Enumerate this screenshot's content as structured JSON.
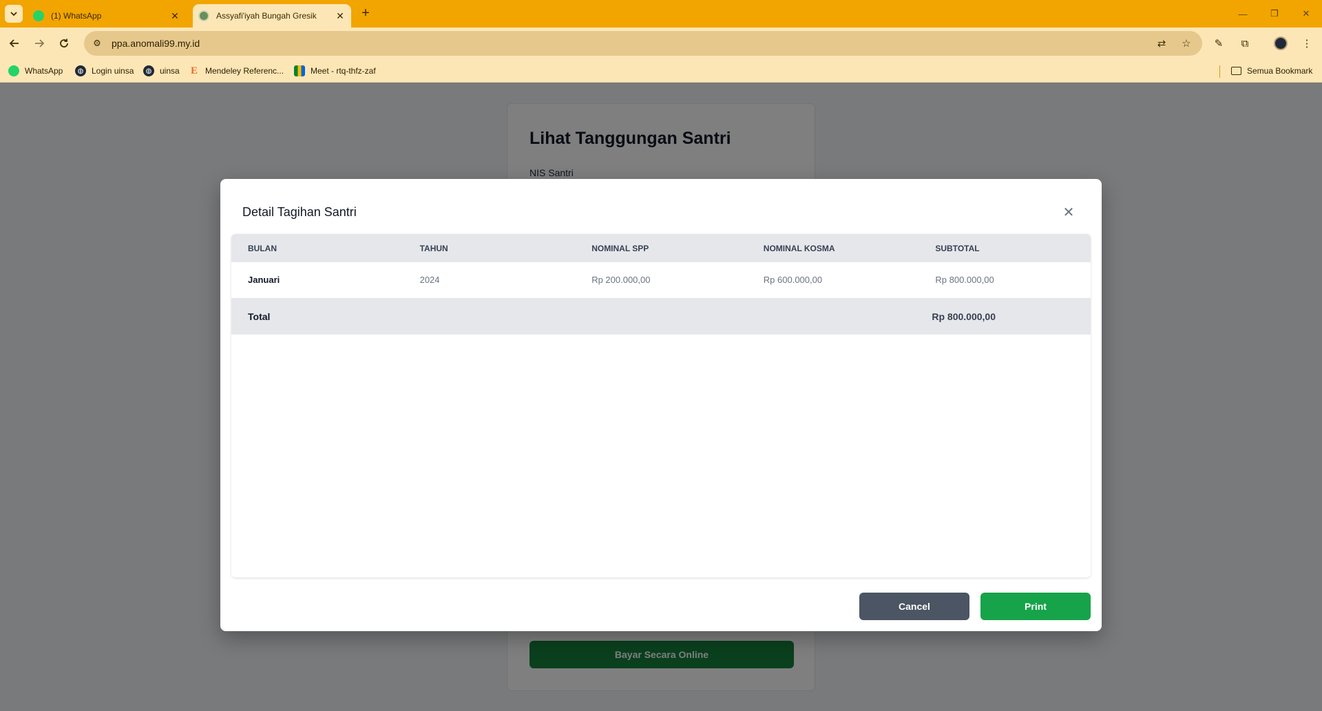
{
  "browser": {
    "tabs": [
      {
        "title": "(1) WhatsApp",
        "favicon": "whatsapp-icon",
        "active": false
      },
      {
        "title": "Assyafi'iyah Bungah Gresik",
        "favicon": "site-icon",
        "active": true
      }
    ],
    "url": "ppa.anomali99.my.id",
    "bookmarks": [
      {
        "label": "WhatsApp",
        "icon": "whatsapp-icon"
      },
      {
        "label": "Login uinsa",
        "icon": "globe-icon"
      },
      {
        "label": "uinsa",
        "icon": "globe-icon"
      },
      {
        "label": "Mendeley Referenc...",
        "icon": "mendeley-icon"
      },
      {
        "label": "Meet - rtq-thfz-zaf",
        "icon": "meet-icon"
      }
    ],
    "all_bookmarks": "Semua Bookmark",
    "colors": {
      "frame": "#f2a500",
      "toolbar": "#fde6b6"
    }
  },
  "page": {
    "title": "Lihat Tanggungan Santri",
    "nis_label": "NIS Santri",
    "online_button": "Bayar Secara Online"
  },
  "modal": {
    "title": "Detail Tagihan Santri",
    "columns": [
      "BULAN",
      "TAHUN",
      "NOMINAL SPP",
      "NOMINAL KOSMA",
      "SUBTOTAL"
    ],
    "rows": [
      {
        "bulan": "Januari",
        "tahun": "2024",
        "spp": "Rp 200.000,00",
        "kosma": "Rp 600.000,00",
        "subtotal": "Rp 800.000,00"
      }
    ],
    "total_label": "Total",
    "total_value": "Rp 800.000,00",
    "cancel_label": "Cancel",
    "print_label": "Print",
    "colors": {
      "cancel": "#4b5563",
      "print": "#16a34a",
      "header_bg": "#e5e7eb"
    }
  }
}
